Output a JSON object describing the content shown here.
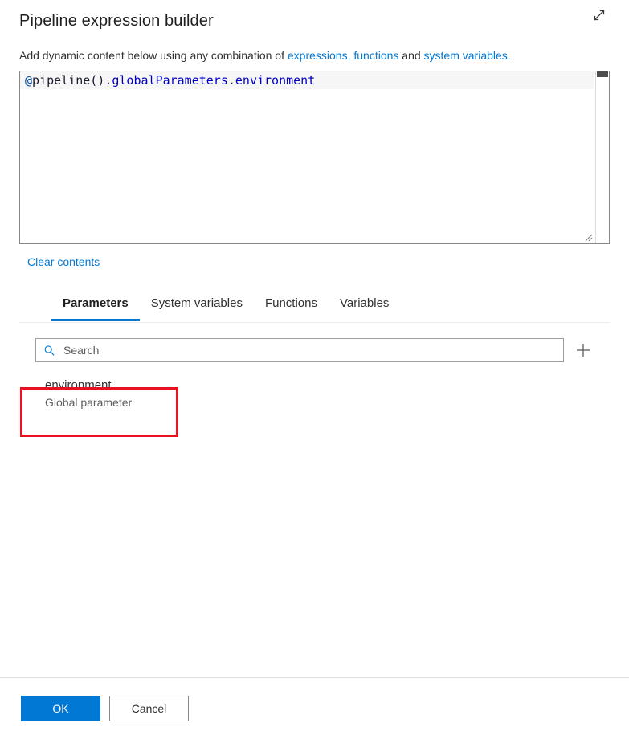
{
  "header": {
    "title": "Pipeline expression builder",
    "expand_icon": "expand-diagonal-icon"
  },
  "subtitle": {
    "text_before": "Add dynamic content below using any combination of ",
    "link_expressions": "expressions, functions",
    "text_middle": " and ",
    "link_system_variables": "system variables."
  },
  "editor": {
    "expression": "@pipeline().globalParameters.environment",
    "tokens": {
      "at": "@",
      "func": "pipeline()",
      "dot1": ".",
      "prop1": "globalParameters",
      "dot2": ".",
      "prop2": "environment"
    },
    "clear_label": "Clear contents",
    "scrollbar": "vertical-scrollbar",
    "resize_grip": "resize-grip-icon"
  },
  "tabs": [
    {
      "label": "Parameters",
      "active": true
    },
    {
      "label": "System variables",
      "active": false
    },
    {
      "label": "Functions",
      "active": false
    },
    {
      "label": "Variables",
      "active": false
    }
  ],
  "search": {
    "value": "",
    "placeholder": "Search",
    "icon": "search-icon",
    "add_icon": "plus-icon"
  },
  "parameters": [
    {
      "name": "environment",
      "type": "Global parameter",
      "highlighted": true
    }
  ],
  "footer": {
    "ok_label": "OK",
    "cancel_label": "Cancel"
  },
  "colors": {
    "accent": "#0078d4",
    "link": "#0078d4",
    "annotation": "#e81123",
    "text": "#323130",
    "muted": "#605e5c",
    "border": "#8a8886"
  }
}
